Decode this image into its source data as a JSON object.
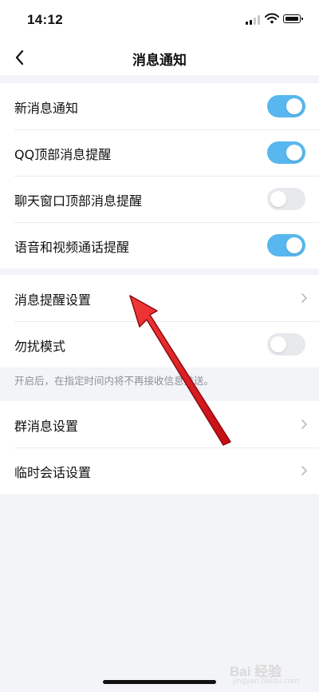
{
  "status_bar": {
    "time": "14:12"
  },
  "nav": {
    "title": "消息通知"
  },
  "group1": [
    {
      "label": "新消息通知",
      "on": true
    },
    {
      "label": "QQ顶部消息提醒",
      "on": true
    },
    {
      "label": "聊天窗口顶部消息提醒",
      "on": false
    },
    {
      "label": "语音和视频通话提醒",
      "on": true
    }
  ],
  "group2": [
    {
      "label": "消息提醒设置"
    },
    {
      "label": "勿扰模式",
      "on": false
    }
  ],
  "hint": "开启后，在指定时间内将不再接收信息推送。",
  "group3": [
    {
      "label": "群消息设置"
    },
    {
      "label": "临时会话设置"
    }
  ],
  "watermark": {
    "text": "Bai 经验",
    "sub": "jingyan.baidu.com"
  },
  "colors": {
    "toggle_on": "#58b7ee",
    "toggle_off": "#e8e9ed",
    "background": "#f3f4f7",
    "annotation_arrow": "#e0141e"
  },
  "icons": [
    "back-chevron-icon",
    "signal-icon",
    "wifi-icon",
    "battery-icon",
    "chevron-right-icon"
  ]
}
